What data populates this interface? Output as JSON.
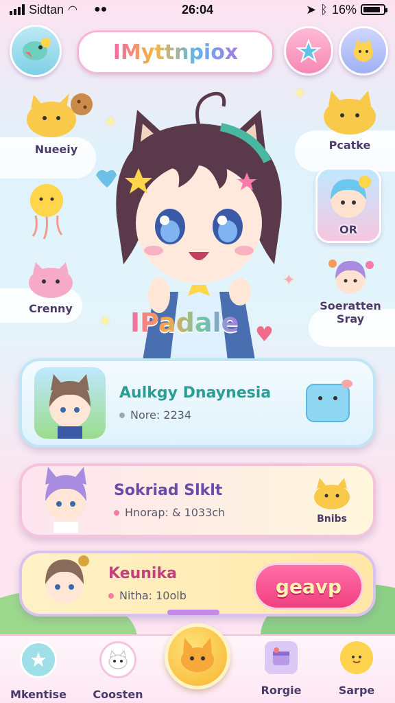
{
  "status": {
    "carrier": "Sidtan",
    "time": "26:04",
    "battery": "16%",
    "battery_level": 0.85
  },
  "header": {
    "logo_text": "IMyttnpiox",
    "menu_icon": "bird-chat-icon",
    "star_icon": "star-icon",
    "pet_icon": "cat-face-icon"
  },
  "side_left": [
    {
      "label": "Nueeiy",
      "icon": "cat-cookie-icon"
    },
    {
      "label": "",
      "icon": "sun-jellyfish-icon"
    },
    {
      "label": "Crenny",
      "icon": "pink-cat-icon"
    }
  ],
  "side_right": [
    {
      "label": "Pcatke",
      "icon": "yellow-cat-icon"
    },
    {
      "label": "OR",
      "icon": "blue-hair-chibi-icon"
    },
    {
      "label": "Soeratten Sray",
      "icon": "purple-hair-chibi-icon"
    }
  ],
  "hero": {
    "name": "IPadale"
  },
  "cards": [
    {
      "title": "Aulkgy Dnaynesia",
      "meta": "Nore: 2234",
      "accent": "#2a9d95",
      "side_icon": "blue-box-pet-icon"
    },
    {
      "title": "Sokriad Slklt",
      "meta": "Hnorap: & 1033ch",
      "accent": "#6b4aa8",
      "side_label": "Bnibs",
      "side_icon": "yellow-cat-icon"
    },
    {
      "title": "Keunika",
      "meta": "Nitha: 10olb",
      "accent": "#c2407e",
      "button": "geavp"
    }
  ],
  "nav": [
    {
      "label": "Mkentise",
      "icon": "star-bubble-icon"
    },
    {
      "label": "Coosten",
      "icon": "white-cat-icon"
    },
    {
      "label": "",
      "icon": "cat-home-icon"
    },
    {
      "label": "Rorgie",
      "icon": "calendar-box-icon"
    },
    {
      "label": "Sarpe",
      "icon": "cat-emoji-icon"
    }
  ],
  "colors": {
    "pink": "#f06aa8",
    "yellow": "#f7c64a",
    "teal": "#2a9d95",
    "purple": "#6b4aa8"
  }
}
